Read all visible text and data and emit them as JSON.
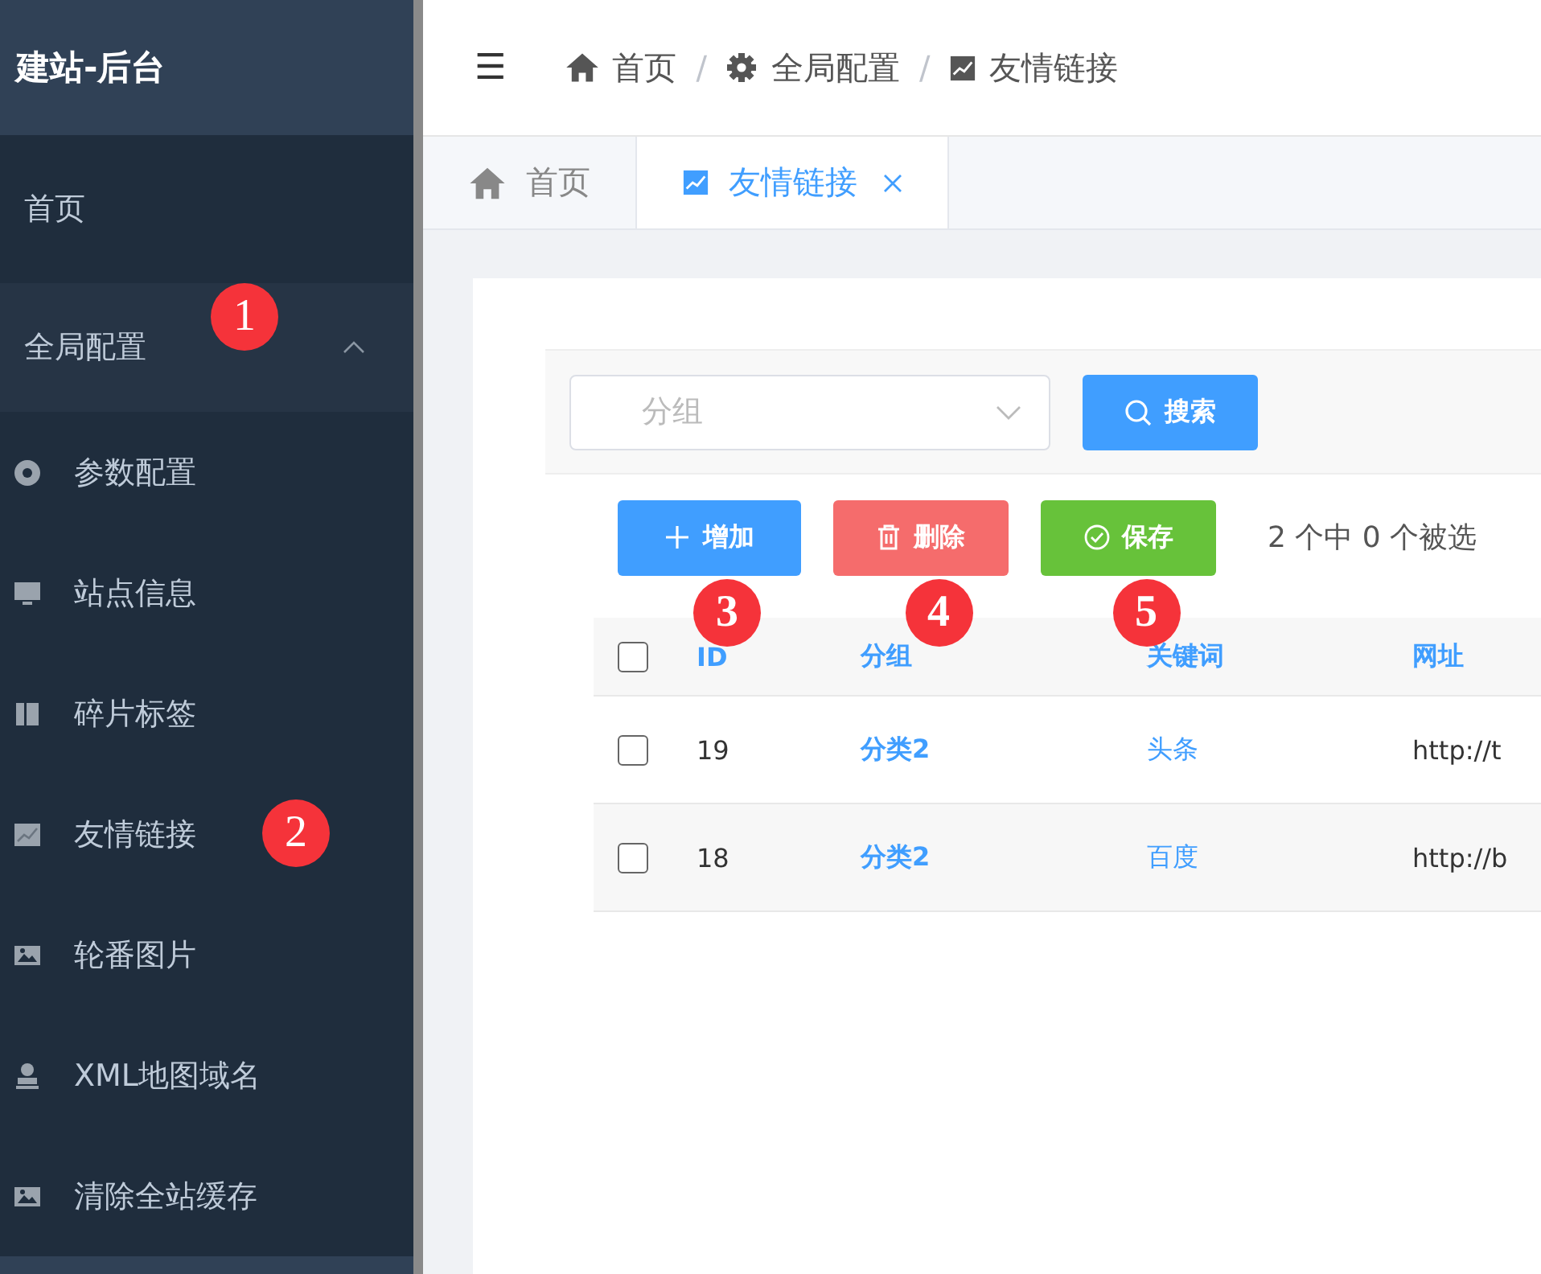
{
  "sidebar": {
    "title": "建站-后台",
    "items": [
      {
        "label": "首页",
        "kind": "top"
      },
      {
        "label": "全局配置",
        "kind": "group",
        "expanded": true,
        "marker": "1",
        "children": [
          {
            "label": "参数配置"
          },
          {
            "label": "站点信息"
          },
          {
            "label": "碎片标签"
          },
          {
            "label": "友情链接",
            "marker": "2"
          },
          {
            "label": "轮番图片"
          },
          {
            "label": "XML地图域名"
          },
          {
            "label": "清除全站缓存"
          }
        ]
      }
    ]
  },
  "header": {
    "menu_glyph": "☰",
    "breadcrumb": [
      "首页",
      "全局配置",
      "友情链接"
    ],
    "separator": "/"
  },
  "tabs": [
    {
      "label": "首页",
      "selected": false,
      "closable": false
    },
    {
      "label": "友情链接",
      "selected": true,
      "closable": true
    }
  ],
  "filter": {
    "placeholder": "分组",
    "search_button": "搜索"
  },
  "actions": [
    {
      "label": "增加",
      "kind": "add",
      "marker": "3"
    },
    {
      "label": "删除",
      "kind": "delete",
      "marker": "4"
    },
    {
      "label": "保存",
      "kind": "save",
      "marker": "5"
    }
  ],
  "selection_text": "2 个中 0 个被选",
  "table": {
    "select_all_checked": false,
    "columns": [
      "ID",
      "分组",
      "关键词",
      "网址"
    ],
    "rows": [
      {
        "checked": false,
        "cells": [
          "19",
          "分类2",
          "头条",
          "http://t"
        ]
      },
      {
        "checked": false,
        "cells": [
          "18",
          "分类2",
          "百度",
          "http://b"
        ]
      }
    ]
  }
}
